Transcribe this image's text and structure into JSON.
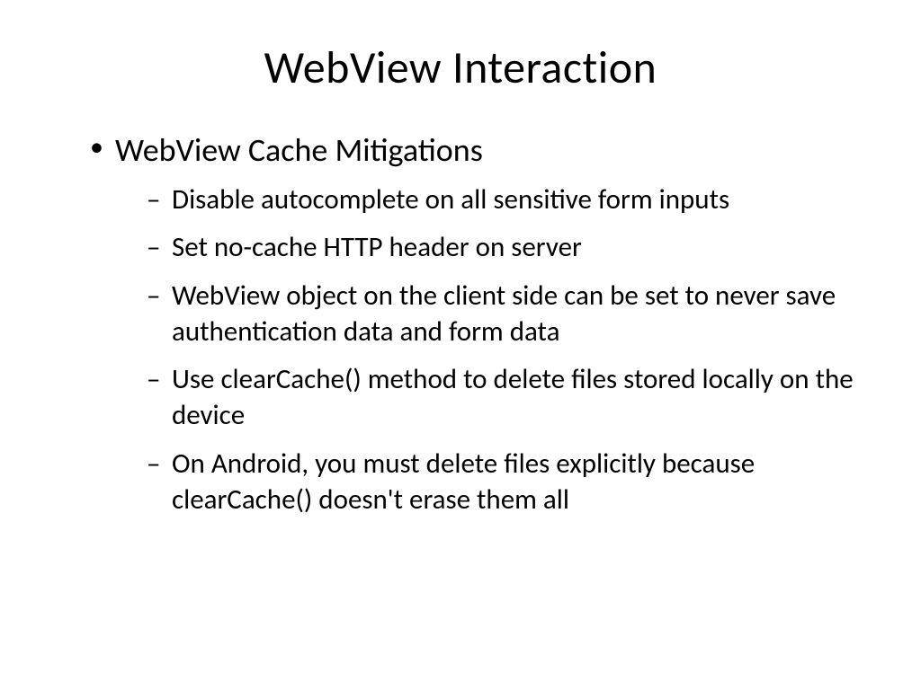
{
  "slide": {
    "title": "WebView Interaction",
    "bullet1": "WebView Cache Mitigations",
    "sub1": "Disable autocomplete on all sensitive form inputs",
    "sub2": "Set no-cache HTTP header on server",
    "sub3": "WebView object on the client side can be set to never save authentication data and form data",
    "sub4": "Use clearCache() method to delete files stored locally on the device",
    "sub5": "On Android, you must delete files explicitly because clearCache() doesn't erase them all"
  }
}
